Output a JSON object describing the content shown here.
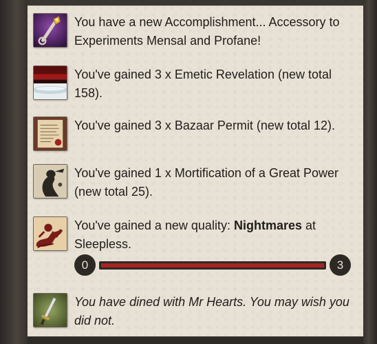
{
  "items": [
    {
      "icon": "golden-key-icon",
      "text": "You have a new Accomplishment... Accessory to Experiments Mensal and Profane!"
    },
    {
      "icon": "emetic-revelation-icon",
      "text": "You've gained 3 x Emetic Revelation (new total 158)."
    },
    {
      "icon": "bazaar-permit-icon",
      "text": "You've gained 3 x Bazaar Permit (new total 12)."
    },
    {
      "icon": "mortification-icon",
      "text": "You've gained 1 x Mortification of a Great Power (new total 25)."
    },
    {
      "icon": "nightmares-icon",
      "text_before": "You've gained a new quality: ",
      "quality_name": "Nightmares",
      "text_after": " at Sleepless."
    },
    {
      "icon": "dagger-icon",
      "text": "You have dined with Mr Hearts. You may wish you did not."
    }
  ],
  "quality_progress": {
    "min_label": "0",
    "max_label": "3",
    "fill_fraction": 1.0
  },
  "colors": {
    "panel": "#e8e2d6",
    "bar_fill": "#a82421",
    "pip": "#2d2925"
  }
}
